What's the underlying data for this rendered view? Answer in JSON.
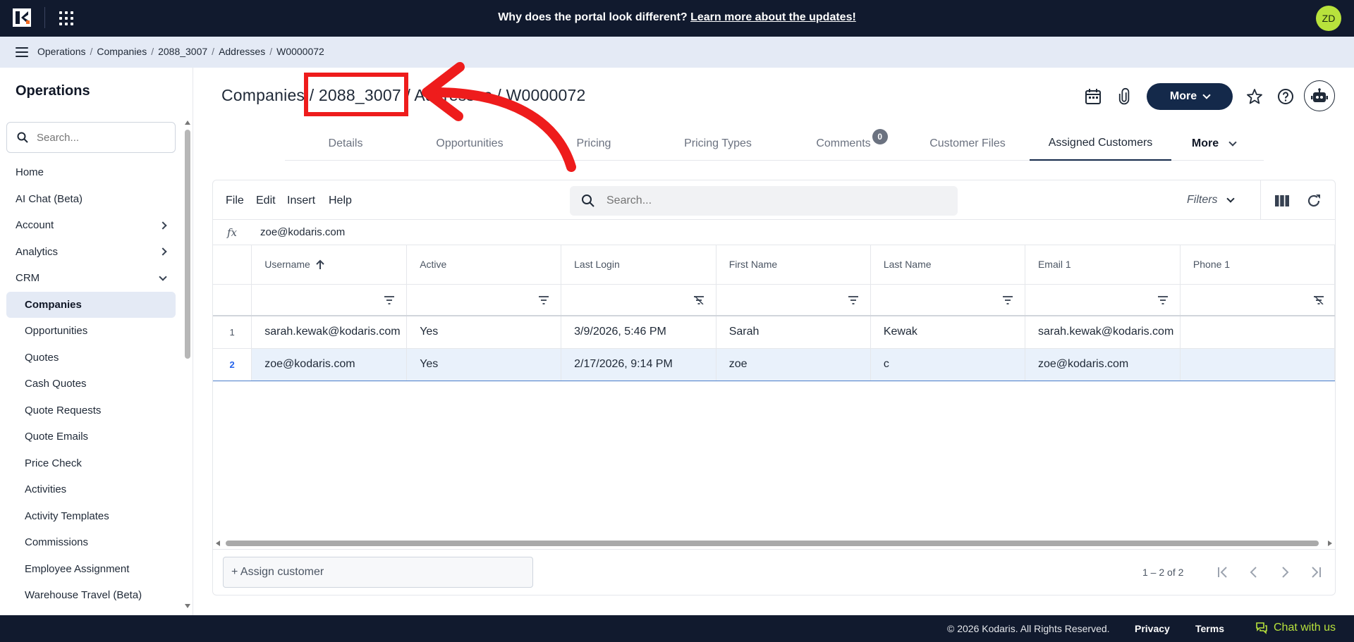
{
  "topbar": {
    "announcement_text": "Why does the portal look different? ",
    "announcement_link": "Learn more about the updates!",
    "avatar_initials": "ZD"
  },
  "breadcrumb": [
    "Operations",
    "Companies",
    "2088_3007",
    "Addresses",
    "W0000072"
  ],
  "sidebar": {
    "title": "Operations",
    "search_placeholder": "Search...",
    "items": [
      {
        "label": "Home"
      },
      {
        "label": "AI Chat (Beta)"
      },
      {
        "label": "Account"
      },
      {
        "label": "Analytics"
      },
      {
        "label": "CRM"
      },
      {
        "label": "Companies"
      },
      {
        "label": "Opportunities"
      },
      {
        "label": "Quotes"
      },
      {
        "label": "Cash Quotes"
      },
      {
        "label": "Quote Requests"
      },
      {
        "label": "Quote Emails"
      },
      {
        "label": "Price Check"
      },
      {
        "label": "Activities"
      },
      {
        "label": "Activity Templates"
      },
      {
        "label": "Commissions"
      },
      {
        "label": "Employee Assignment"
      },
      {
        "label": "Warehouse Travel (Beta)"
      }
    ]
  },
  "header": {
    "title_part1": "Companies / ",
    "title_part2": "2088_3007",
    "title_part3": " / Addresses / W0000072",
    "more_label": "More"
  },
  "tabs": [
    {
      "label": "Details"
    },
    {
      "label": "Opportunities"
    },
    {
      "label": "Pricing"
    },
    {
      "label": "Pricing Types"
    },
    {
      "label": "Comments",
      "badge": "0"
    },
    {
      "label": "Customer Files"
    },
    {
      "label": "Assigned Customers"
    },
    {
      "label": "More"
    }
  ],
  "grid": {
    "menus": [
      "File",
      "Edit",
      "Insert",
      "Help"
    ],
    "search_placeholder": "Search...",
    "filters_label": "Filters",
    "fx_label": "fx",
    "formula_value": "zoe@kodaris.com",
    "columns": [
      "Username",
      "Active",
      "Last Login",
      "First Name",
      "Last Name",
      "Email 1",
      "Phone 1"
    ],
    "rows": [
      {
        "num": "1",
        "cells": [
          "sarah.kewak@kodaris.com",
          "Yes",
          "3/9/2026, 5:46 PM",
          "Sarah",
          "Kewak",
          "sarah.kewak@kodaris.com",
          ""
        ]
      },
      {
        "num": "2",
        "cells": [
          "zoe@kodaris.com",
          "Yes",
          "2/17/2026, 9:14 PM",
          "zoe",
          "c",
          "zoe@kodaris.com",
          ""
        ]
      }
    ],
    "assign_label": "+ Assign customer",
    "pager_text": "1 – 2 of 2"
  },
  "footer": {
    "copyright": "© 2026 Kodaris. All Rights Reserved.",
    "privacy": "Privacy",
    "terms": "Terms",
    "chat": "Chat with us"
  },
  "colors": {
    "navy": "#111a2e",
    "accent": "#14294a",
    "lime": "#b8e23c",
    "annotation_red": "#ee1c1c"
  }
}
